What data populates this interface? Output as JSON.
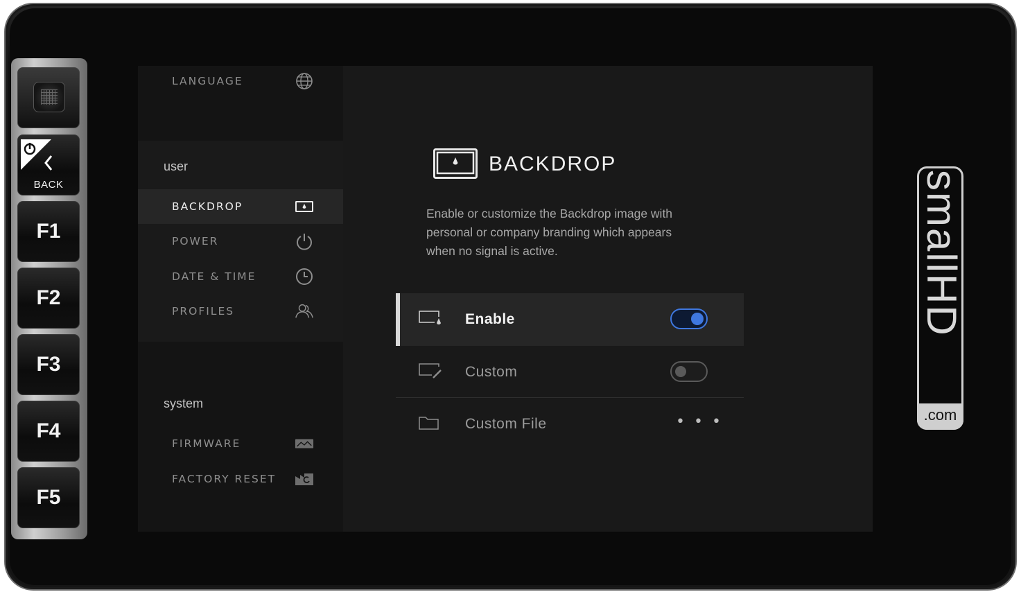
{
  "hardware": {
    "back_label": "BACK",
    "f_buttons": [
      "F1",
      "F2",
      "F3",
      "F4",
      "F5"
    ]
  },
  "sidebar": {
    "top_item": {
      "label": "LANGUAGE",
      "icon": "globe-icon"
    },
    "user_section": {
      "title": "user",
      "items": [
        {
          "label": "BACKDROP",
          "icon": "backdrop-icon",
          "active": true
        },
        {
          "label": "POWER",
          "icon": "power-icon",
          "active": false
        },
        {
          "label": "DATE & TIME",
          "icon": "clock-icon",
          "active": false
        },
        {
          "label": "PROFILES",
          "icon": "profiles-icon",
          "active": false
        }
      ]
    },
    "system_section": {
      "title": "system",
      "items": [
        {
          "label": "FIRMWARE",
          "icon": "firmware-icon"
        },
        {
          "label": "FACTORY RESET",
          "icon": "factory-reset-icon"
        }
      ]
    }
  },
  "main": {
    "title": "BACKDROP",
    "description": "Enable or customize the Backdrop image with personal or company branding which appears when no signal is active.",
    "rows": [
      {
        "label": "Enable",
        "icon": "backdrop-drop-icon",
        "control": "toggle",
        "on": true,
        "selected": true
      },
      {
        "label": "Custom",
        "icon": "edit-icon",
        "control": "toggle",
        "on": false,
        "selected": false
      },
      {
        "label": "Custom File",
        "icon": "folder-icon",
        "control": "more",
        "value": "• • •",
        "selected": false
      }
    ]
  },
  "logo": {
    "brand": "smallHD",
    "suffix": ".com"
  },
  "colors": {
    "accent": "#3f78e0",
    "background": "#191919",
    "sidebar": "#141414"
  }
}
